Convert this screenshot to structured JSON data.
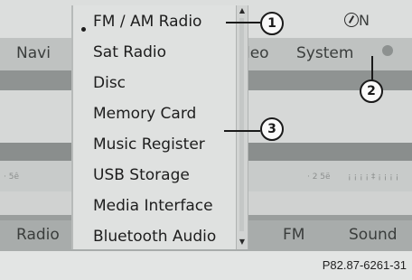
{
  "status": {
    "compass_letter": "N"
  },
  "nav_bar": {
    "left": "Navi",
    "partial": "leo",
    "right": "System"
  },
  "faint_row": {
    "left": "· 5ê",
    "mid": "· 2 5ë",
    "right": "¡ ¡ ¡ ¡ ‡ ¡ ¡ ¡ ¡"
  },
  "bottom_bar": {
    "left": "Radio",
    "mid": "FM",
    "right": "Sound"
  },
  "menu": {
    "items": [
      {
        "label": "FM / AM Radio",
        "selected": true
      },
      {
        "label": "Sat Radio"
      },
      {
        "label": "Disc"
      },
      {
        "label": "Memory Card"
      },
      {
        "label": "Music Register"
      },
      {
        "label": "USB Storage"
      },
      {
        "label": "Media Interface"
      },
      {
        "label": "Bluetooth Audio"
      }
    ]
  },
  "callouts": [
    "1",
    "2",
    "3"
  ],
  "figure_ref": "P82.87-6261-31"
}
